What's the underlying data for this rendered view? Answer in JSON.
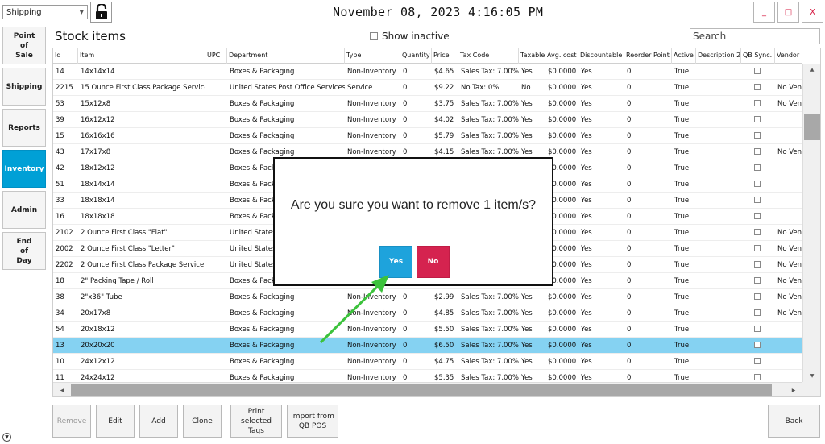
{
  "top": {
    "location_select": "Shipping",
    "clock": "November 08, 2023 4:16:05 PM",
    "window_min": "_",
    "window_max": "□",
    "window_close": "X"
  },
  "sidebar": {
    "items": [
      {
        "label": "Point\nof\nSale",
        "active": false
      },
      {
        "label": "Shipping",
        "active": false
      },
      {
        "label": "Reports",
        "active": false
      },
      {
        "label": "Inventory",
        "active": true
      },
      {
        "label": "Admin",
        "active": false
      },
      {
        "label": "End\nof\nDay",
        "active": false
      }
    ]
  },
  "main": {
    "title": "Stock items",
    "show_inactive": "Show inactive",
    "search_placeholder": "Search"
  },
  "table": {
    "columns": [
      "Id",
      "Item",
      "UPC",
      "Department",
      "Type",
      "Quantity",
      "Price",
      "Tax Code",
      "Taxable",
      "Avg. cost",
      "Discountable",
      "Reorder Point",
      "Active",
      "Description 2",
      "QB Sync.",
      "Vendor"
    ],
    "rows": [
      {
        "id": "14",
        "item": "14x14x14",
        "upc": "",
        "dept": "Boxes & Packaging",
        "type": "Non-Inventory",
        "qty": "0",
        "price": "$4.65",
        "tax": "Sales Tax: 7.00%",
        "taxable": "Yes",
        "avg": "$0.0000",
        "disc": "Yes",
        "reorder": "0",
        "active": "True",
        "desc2": "",
        "vendor": ""
      },
      {
        "id": "2215",
        "item": "15 Ounce First Class Package Service",
        "upc": "",
        "dept": "United States Post Office Services",
        "type": "Service",
        "qty": "0",
        "price": "$9.22",
        "tax": "No Tax: 0%",
        "taxable": "No",
        "avg": "$0.0000",
        "disc": "Yes",
        "reorder": "0",
        "active": "True",
        "desc2": "",
        "vendor": "No Vend"
      },
      {
        "id": "53",
        "item": "15x12x8",
        "upc": "",
        "dept": "Boxes & Packaging",
        "type": "Non-Inventory",
        "qty": "0",
        "price": "$3.75",
        "tax": "Sales Tax: 7.00%",
        "taxable": "Yes",
        "avg": "$0.0000",
        "disc": "Yes",
        "reorder": "0",
        "active": "True",
        "desc2": "",
        "vendor": "No Vend"
      },
      {
        "id": "39",
        "item": "16x12x12",
        "upc": "",
        "dept": "Boxes & Packaging",
        "type": "Non-Inventory",
        "qty": "0",
        "price": "$4.02",
        "tax": "Sales Tax: 7.00%",
        "taxable": "Yes",
        "avg": "$0.0000",
        "disc": "Yes",
        "reorder": "0",
        "active": "True",
        "desc2": "",
        "vendor": ""
      },
      {
        "id": "15",
        "item": "16x16x16",
        "upc": "",
        "dept": "Boxes & Packaging",
        "type": "Non-Inventory",
        "qty": "0",
        "price": "$5.79",
        "tax": "Sales Tax: 7.00%",
        "taxable": "Yes",
        "avg": "$0.0000",
        "disc": "Yes",
        "reorder": "0",
        "active": "True",
        "desc2": "",
        "vendor": ""
      },
      {
        "id": "43",
        "item": "17x17x8",
        "upc": "",
        "dept": "Boxes & Packaging",
        "type": "Non-Inventory",
        "qty": "0",
        "price": "$4.15",
        "tax": "Sales Tax: 7.00%",
        "taxable": "Yes",
        "avg": "$0.0000",
        "disc": "Yes",
        "reorder": "0",
        "active": "True",
        "desc2": "",
        "vendor": "No Vend"
      },
      {
        "id": "42",
        "item": "18x12x12",
        "upc": "",
        "dept": "Boxes & Packag",
        "type": "",
        "qty": "",
        "price": "",
        "tax": "",
        "taxable": "",
        "avg": "$0.0000",
        "disc": "Yes",
        "reorder": "0",
        "active": "True",
        "desc2": "",
        "vendor": ""
      },
      {
        "id": "51",
        "item": "18x14x14",
        "upc": "",
        "dept": "Boxes & Packag",
        "type": "",
        "qty": "",
        "price": "",
        "tax": "",
        "taxable": "",
        "avg": "$0.0000",
        "disc": "Yes",
        "reorder": "0",
        "active": "True",
        "desc2": "",
        "vendor": ""
      },
      {
        "id": "33",
        "item": "18x18x14",
        "upc": "",
        "dept": "Boxes & Packag",
        "type": "",
        "qty": "",
        "price": "",
        "tax": "",
        "taxable": "",
        "avg": "$0.0000",
        "disc": "Yes",
        "reorder": "0",
        "active": "True",
        "desc2": "",
        "vendor": ""
      },
      {
        "id": "16",
        "item": "18x18x18",
        "upc": "",
        "dept": "Boxes & Packag",
        "type": "",
        "qty": "",
        "price": "",
        "tax": "",
        "taxable": "",
        "avg": "$0.0000",
        "disc": "Yes",
        "reorder": "0",
        "active": "True",
        "desc2": "",
        "vendor": ""
      },
      {
        "id": "2102",
        "item": "2 Ounce First Class \"Flat\"",
        "upc": "",
        "dept": "United States",
        "type": "",
        "qty": "",
        "price": "",
        "tax": "",
        "taxable": "",
        "avg": "$0.0000",
        "disc": "Yes",
        "reorder": "0",
        "active": "True",
        "desc2": "",
        "vendor": "No Vend"
      },
      {
        "id": "2002",
        "item": "2 Ounce First Class \"Letter\"",
        "upc": "",
        "dept": "United States",
        "type": "",
        "qty": "",
        "price": "",
        "tax": "",
        "taxable": "",
        "avg": "$0.0000",
        "disc": "Yes",
        "reorder": "0",
        "active": "True",
        "desc2": "",
        "vendor": "No Vend"
      },
      {
        "id": "2202",
        "item": "2 Ounce First Class Package Service",
        "upc": "",
        "dept": "United States",
        "type": "",
        "qty": "",
        "price": "",
        "tax": "",
        "taxable": "",
        "avg": "$0.0000",
        "disc": "Yes",
        "reorder": "0",
        "active": "True",
        "desc2": "",
        "vendor": "No Vend"
      },
      {
        "id": "18",
        "item": "2\" Packing Tape / Roll",
        "upc": "",
        "dept": "Boxes & Packag",
        "type": "",
        "qty": "",
        "price": "",
        "tax": "",
        "taxable": "",
        "avg": "$0.0000",
        "disc": "Yes",
        "reorder": "0",
        "active": "True",
        "desc2": "",
        "vendor": "No Vend"
      },
      {
        "id": "38",
        "item": "2\"x36\" Tube",
        "upc": "",
        "dept": "Boxes & Packaging",
        "type": "Non-Inventory",
        "qty": "0",
        "price": "$2.99",
        "tax": "Sales Tax: 7.00%",
        "taxable": "Yes",
        "avg": "$0.0000",
        "disc": "Yes",
        "reorder": "0",
        "active": "True",
        "desc2": "",
        "vendor": "No Vend"
      },
      {
        "id": "34",
        "item": "20x17x8",
        "upc": "",
        "dept": "Boxes & Packaging",
        "type": "Non-Inventory",
        "qty": "0",
        "price": "$4.85",
        "tax": "Sales Tax: 7.00%",
        "taxable": "Yes",
        "avg": "$0.0000",
        "disc": "Yes",
        "reorder": "0",
        "active": "True",
        "desc2": "",
        "vendor": "No Vend"
      },
      {
        "id": "54",
        "item": "20x18x12",
        "upc": "",
        "dept": "Boxes & Packaging",
        "type": "Non-Inventory",
        "qty": "0",
        "price": "$5.50",
        "tax": "Sales Tax: 7.00%",
        "taxable": "Yes",
        "avg": "$0.0000",
        "disc": "Yes",
        "reorder": "0",
        "active": "True",
        "desc2": "",
        "vendor": ""
      },
      {
        "id": "13",
        "item": "20x20x20",
        "upc": "",
        "dept": "Boxes & Packaging",
        "type": "Non-Inventory",
        "qty": "0",
        "price": "$6.50",
        "tax": "Sales Tax: 7.00%",
        "taxable": "Yes",
        "avg": "$0.0000",
        "disc": "Yes",
        "reorder": "0",
        "active": "True",
        "desc2": "",
        "vendor": "",
        "selected": true
      },
      {
        "id": "10",
        "item": "24x12x12",
        "upc": "",
        "dept": "Boxes & Packaging",
        "type": "Non-Inventory",
        "qty": "0",
        "price": "$4.75",
        "tax": "Sales Tax: 7.00%",
        "taxable": "Yes",
        "avg": "$0.0000",
        "disc": "Yes",
        "reorder": "0",
        "active": "True",
        "desc2": "",
        "vendor": ""
      },
      {
        "id": "11",
        "item": "24x24x12",
        "upc": "",
        "dept": "Boxes & Packaging",
        "type": "Non-Inventory",
        "qty": "0",
        "price": "$5.35",
        "tax": "Sales Tax: 7.00%",
        "taxable": "Yes",
        "avg": "$0.0000",
        "disc": "Yes",
        "reorder": "0",
        "active": "True",
        "desc2": "",
        "vendor": ""
      }
    ]
  },
  "bottom": {
    "remove": "Remove",
    "edit": "Edit",
    "add": "Add",
    "clone": "Clone",
    "print_tags": "Print\nselected\nTags",
    "import": "Import from\nQB POS",
    "back": "Back"
  },
  "dialog": {
    "message": "Are you sure you want to remove 1 item/s?",
    "yes": "Yes",
    "no": "No"
  },
  "colors": {
    "accent": "#00a0d6",
    "selected_row": "#85d2f2",
    "yes": "#1ea3dc",
    "no": "#d5234f",
    "annotation_arrow": "#3cc23c"
  }
}
